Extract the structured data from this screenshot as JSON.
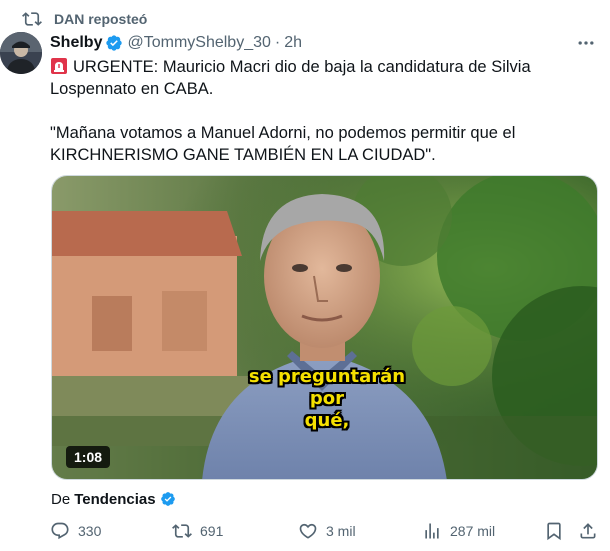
{
  "repost": {
    "text": "DAN reposteó",
    "icon": "repost-icon"
  },
  "author": {
    "name": "Shelby",
    "handle": "@TommyShelby_30",
    "separator": "·",
    "time": "2h",
    "verified": true,
    "avatar": "avatar"
  },
  "tweet": {
    "emoji": "siren-emoji",
    "line1": "URGENTE: Mauricio Macri dio de baja la candidatura de Silvia Lospennato en CABA.",
    "line2": "\"Mañana votamos a Manuel Adorni, no podemos permitir que el KIRCHNERISMO GANE TAMBIÉN EN LA CIUDAD\"."
  },
  "media": {
    "type": "video",
    "caption_line1": "se preguntarán por",
    "caption_line2": "qué,",
    "duration": "1:08"
  },
  "source": {
    "prefix": "De",
    "name": "Tendencias",
    "verified": true
  },
  "actions": {
    "replies": "330",
    "reposts": "691",
    "likes": "3 mil",
    "views": "287 mil"
  },
  "colors": {
    "text": "#0f1419",
    "secondary": "#536471",
    "verified_blue": "#1d9bf0",
    "caption_yellow": "#f5e000",
    "border": "#cfd9de"
  }
}
